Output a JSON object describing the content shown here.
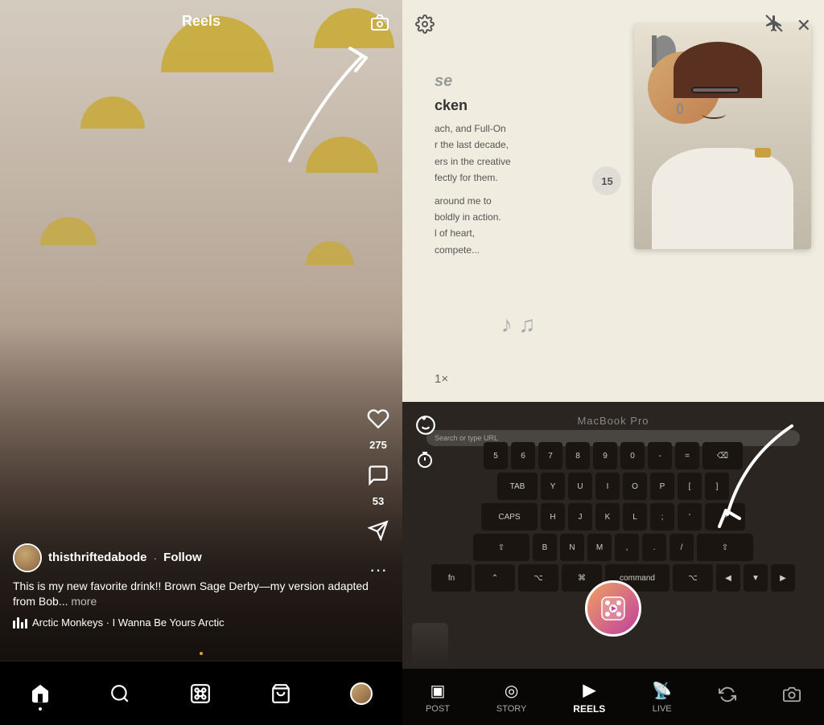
{
  "left": {
    "title": "Reels",
    "username": "thisthriftedabode",
    "follow": "Follow",
    "caption": "This is my new favorite drink!! Brown Sage Derby—my version adapted from Bob...",
    "more": "more",
    "music": "Arctic Monkeys · I Wanna Be Yours  Arctic",
    "likes": "275",
    "comments": "53",
    "camera_icon": "📷",
    "nav": {
      "home": "🏠",
      "search": "🔍",
      "reels": "🎬",
      "shop": "🛍",
      "profile": ""
    }
  },
  "right": {
    "doc": {
      "title_partial": "cken",
      "lines": [
        "ach, and Full-On",
        "r the last decade,",
        "ers in the creative",
        "fectly for them.",
        "around me to",
        "boldly in action.",
        "l of heart,",
        "compete..."
      ],
      "badge": "15",
      "zoom": "1×"
    },
    "macbook_label": "MacBook Pro",
    "top_controls": {
      "settings": "⚙",
      "flash_off": "✈",
      "close": "✕"
    },
    "bottom_nav": {
      "items": [
        "POST",
        "STORY",
        "REELS",
        "LIVE"
      ],
      "active": "REELS",
      "icons": [
        "▣",
        "",
        "",
        ""
      ]
    },
    "effects_icon": "😊",
    "timer_icon": "⏱"
  }
}
